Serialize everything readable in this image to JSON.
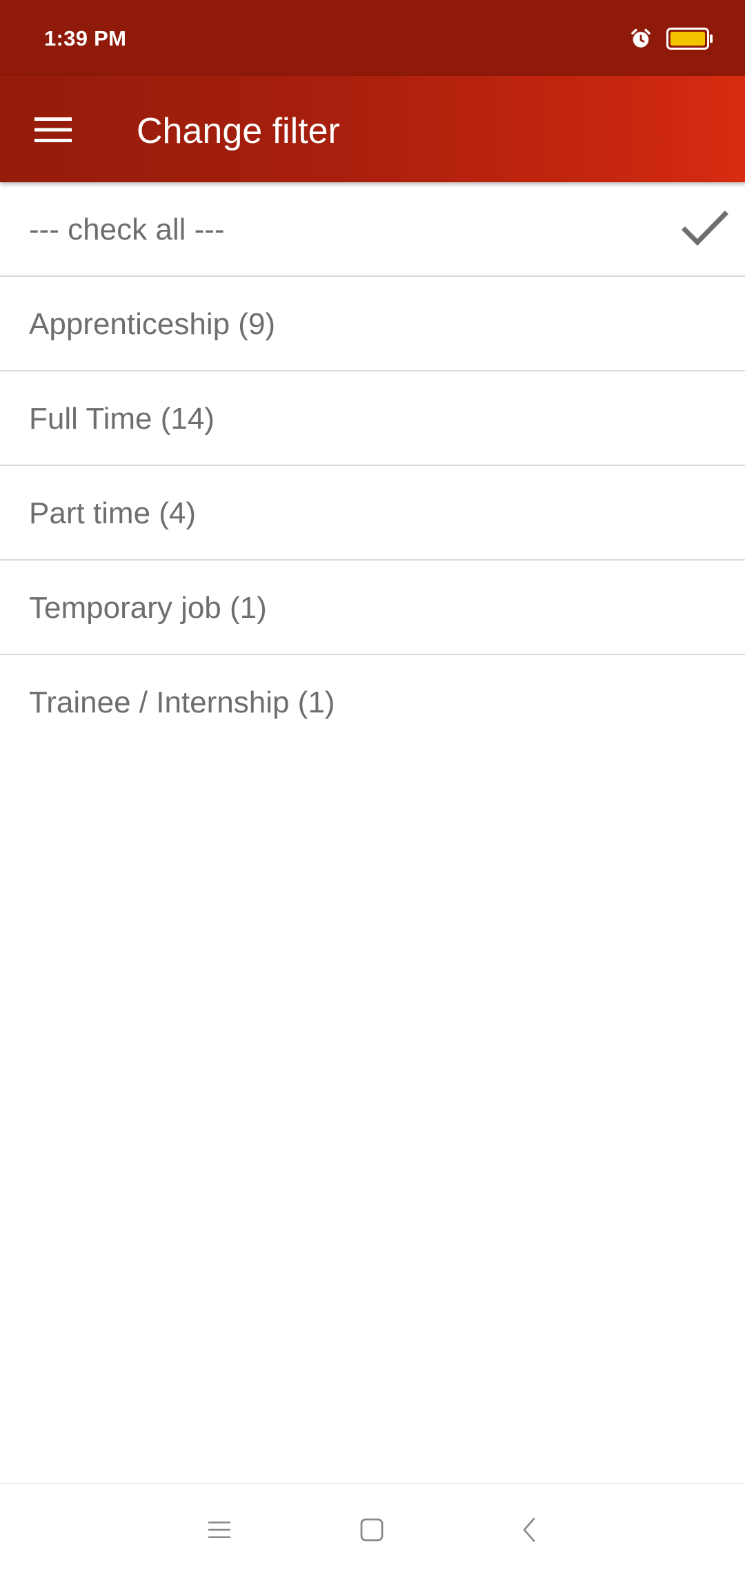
{
  "status_bar": {
    "time": "1:39 PM",
    "icons": [
      "alarm-icon",
      "battery-icon"
    ],
    "battery_color": "#f5c400"
  },
  "app_bar": {
    "title": "Change filter",
    "menu_icon": "hamburger-menu-icon",
    "gradient_colors": [
      "#951c0b",
      "#d72c10"
    ]
  },
  "filters": {
    "check_all": {
      "label": "--- check all ---",
      "checked": true
    },
    "items": [
      {
        "label": "Apprenticeship (9)"
      },
      {
        "label": "Full Time (14)"
      },
      {
        "label": "Part time (4)"
      },
      {
        "label": "Temporary job (1)"
      },
      {
        "label": "Trainee / Internship (1)"
      }
    ]
  },
  "nav_bar": {
    "buttons": [
      "recents-icon",
      "home-icon",
      "back-icon"
    ]
  }
}
